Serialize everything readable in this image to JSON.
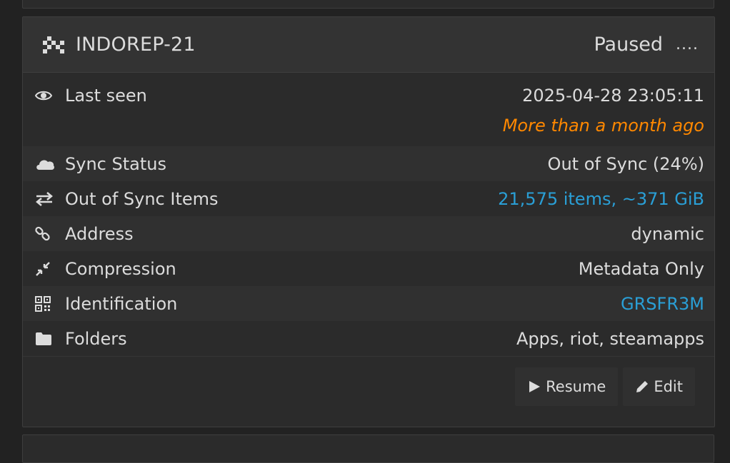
{
  "device": {
    "name": "INDOREP-21",
    "state": "Paused",
    "state_dots": "...."
  },
  "rows": {
    "last_seen": {
      "label": "Last seen",
      "value": "2025-04-28 23:05:11",
      "note": "More than a month ago",
      "icon": "eye-icon"
    },
    "sync_status": {
      "label": "Sync Status",
      "value": "Out of Sync (24%)",
      "icon": "cloud-icon"
    },
    "out_of_sync_items": {
      "label": "Out of Sync Items",
      "value": "21,575 items, ~371 GiB",
      "icon": "exchange-icon"
    },
    "address": {
      "label": "Address",
      "value": "dynamic",
      "icon": "link-icon"
    },
    "compression": {
      "label": "Compression",
      "value": "Metadata Only",
      "icon": "compress-icon"
    },
    "identification": {
      "label": "Identification",
      "value": "GRSFR3M",
      "icon": "qrcode-icon"
    },
    "folders": {
      "label": "Folders",
      "value": "Apps, riot, steamapps",
      "icon": "folder-icon"
    }
  },
  "actions": {
    "resume_label": "Resume",
    "edit_label": "Edit"
  },
  "colors": {
    "background": "#222222",
    "panel": "#2b2b2b",
    "link": "#2a9fd6",
    "warning": "#ff8800"
  }
}
